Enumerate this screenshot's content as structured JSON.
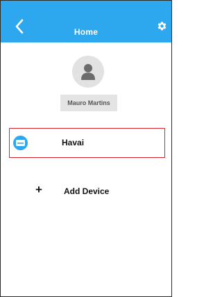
{
  "header": {
    "title": "Home",
    "back_icon": "chevron-left-icon",
    "settings_icon": "gear-icon",
    "background_color": "#2da7ee"
  },
  "profile": {
    "avatar_icon": "user-icon",
    "username": "Mauro Martins"
  },
  "devices": [
    {
      "name": "Havai",
      "icon": "air-conditioner-icon",
      "selected": true
    }
  ],
  "add_device": {
    "icon": "plus-icon",
    "label": "Add Device"
  },
  "colors": {
    "accent": "#2da7ee",
    "selection_border": "#d9232e"
  }
}
